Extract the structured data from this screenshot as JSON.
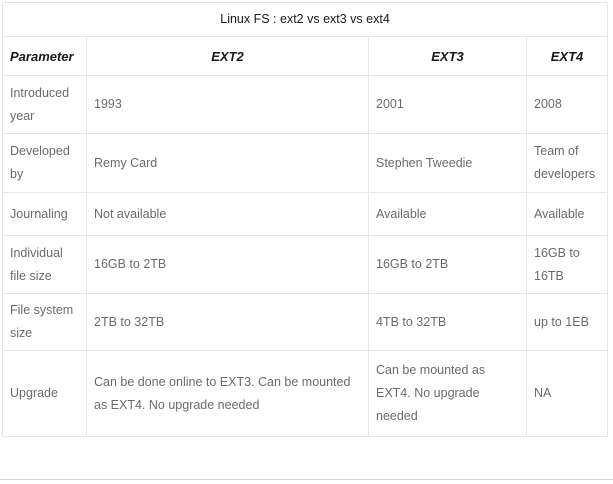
{
  "table": {
    "title": "Linux FS : ext2 vs ext3 vs ext4",
    "headers": [
      "Parameter",
      "EXT2",
      "EXT3",
      "EXT4"
    ],
    "rows": [
      [
        "Introduced year",
        "1993",
        "2001",
        "2008"
      ],
      [
        "Developed by",
        "Remy Card",
        "Stephen Tweedie",
        "Team of developers"
      ],
      [
        "Journaling",
        "Not available",
        "Available",
        "Available"
      ],
      [
        "Individual file size",
        "16GB to 2TB",
        "16GB to 2TB",
        "16GB to 16TB"
      ],
      [
        "File system size",
        "2TB to 32TB",
        "4TB to 32TB",
        "up to 1EB"
      ],
      [
        "Upgrade",
        "Can be done online to EXT3. Can be mounted as EXT4. No upgrade needed",
        "Can be mounted as EXT4. No upgrade needed",
        "NA"
      ]
    ]
  }
}
